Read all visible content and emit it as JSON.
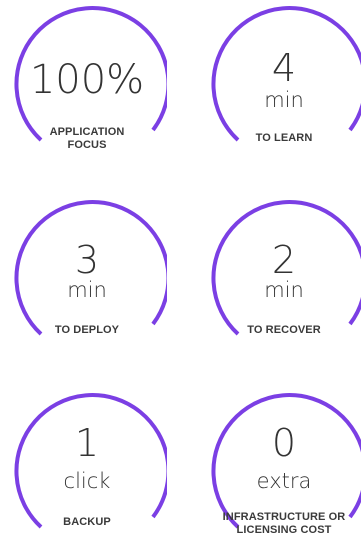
{
  "accent_color": "#7b3fe4",
  "stats": [
    {
      "value": "100%",
      "unit": "",
      "caption": "APPLICATION FOCUS"
    },
    {
      "value": "4",
      "unit": "min",
      "caption": "TO LEARN"
    },
    {
      "value": "3",
      "unit": "min",
      "caption": "TO DEPLOY"
    },
    {
      "value": "2",
      "unit": "min",
      "caption": "TO RECOVER"
    },
    {
      "value": "1",
      "unit": "click",
      "caption": "BACKUP"
    },
    {
      "value": "0",
      "unit": "extra",
      "caption": "INFRASTRUCTURE OR LICENSING COST"
    }
  ]
}
